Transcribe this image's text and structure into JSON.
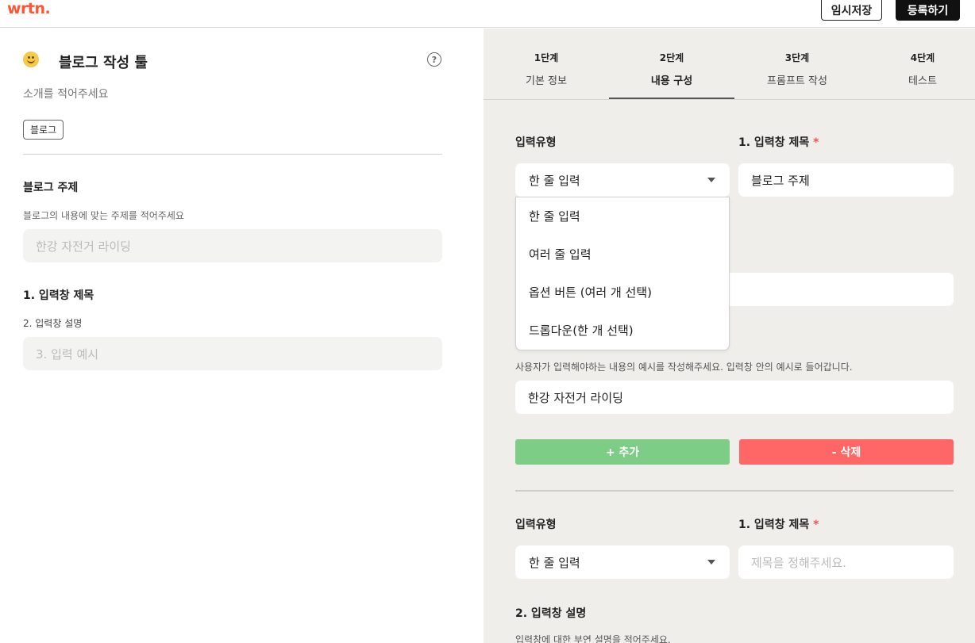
{
  "header": {
    "logo": "wrtn.",
    "temp_save": "임시저장",
    "register": "등록하기"
  },
  "left": {
    "title": "블로그 작성 툴",
    "help_icon": "?",
    "intro": "소개를 적어주세요",
    "tag": "블로그",
    "topic_label": "블로그 주제",
    "topic_desc": "블로그의 내용에 맞는 주제를 적어주세요",
    "topic_placeholder": "한강 자전거 라이딩",
    "field_title": "1. 입력창 제목",
    "field_desc": "2. 입력창 설명",
    "field_example": "3. 입력 예시"
  },
  "tabs": [
    {
      "step": "1단계",
      "name": "기본 정보"
    },
    {
      "step": "2단계",
      "name": "내용 구성"
    },
    {
      "step": "3단계",
      "name": "프롬프트 작성"
    },
    {
      "step": "4단계",
      "name": "테스트"
    }
  ],
  "active_tab": 1,
  "block1": {
    "type_label": "입력유형",
    "type_value": "한 줄 입력",
    "title_label": "1. 입력창 제목",
    "required_mark": "*",
    "title_value": "블로그 주제",
    "example_desc": "사용자가 입력해야하는 내용의 예시를 작성해주세요. 입력창 안의 예시로 들어갑니다.",
    "example_value": "한강 자전거 라이딩",
    "add_button": "+ 추가",
    "delete_button": "- 삭제"
  },
  "dropdown_options": [
    "한 줄 입력",
    "여러 줄 입력",
    "옵션 버튼 (여러 개 선택)",
    "드롭다운(한 개 선택)"
  ],
  "block2": {
    "type_label": "입력유형",
    "type_value": "한 줄 입력",
    "title_label": "1. 입력창 제목",
    "required_mark": "*",
    "title_placeholder": "제목을 정해주세요.",
    "desc_label": "2. 입력창 설명",
    "desc_text": "입력창에 대한 부연 설명을 적어주세요."
  },
  "colors": {
    "brand": "#ff5533",
    "add": "#7ecd86",
    "delete": "#ff6767",
    "panel_bg": "#efeeeb"
  }
}
